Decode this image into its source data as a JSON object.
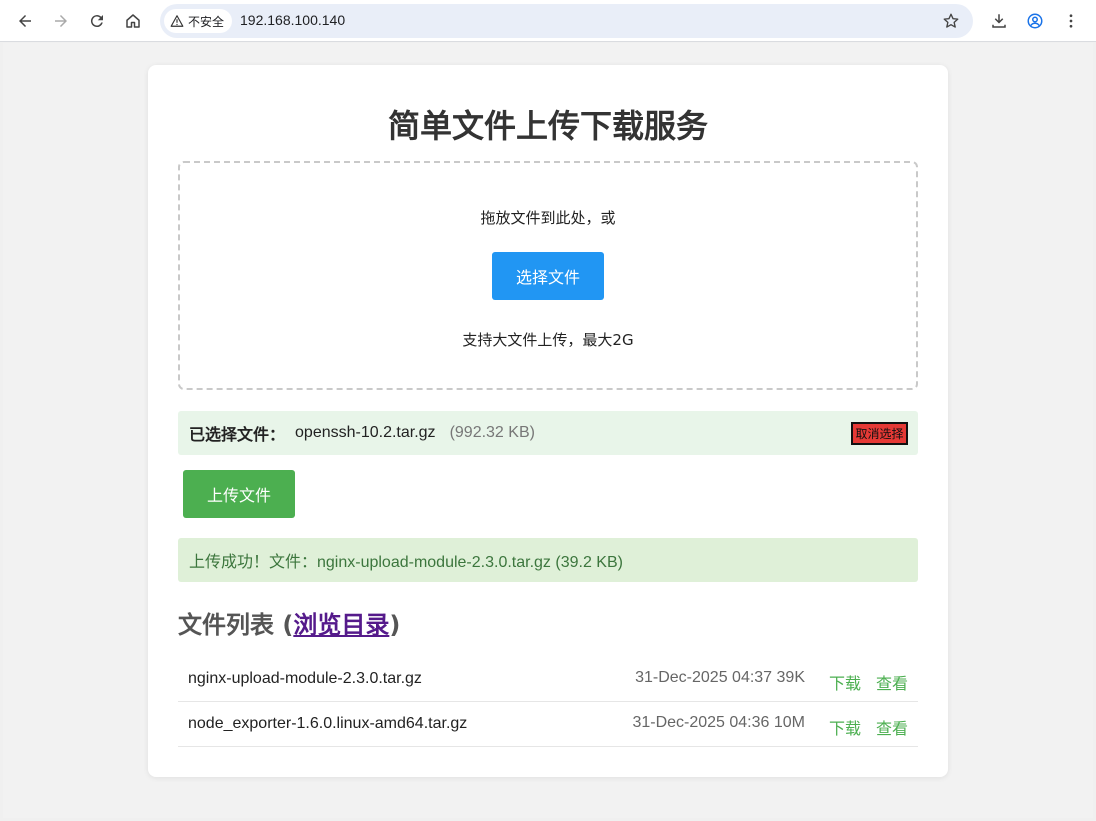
{
  "browser": {
    "security_label": "不安全",
    "url": "192.168.100.140"
  },
  "page": {
    "title": "简单文件上传下载服务",
    "dropzone": {
      "hint": "拖放文件到此处，或",
      "choose_button": "选择文件",
      "size_hint": "支持大文件上传，最大2G"
    },
    "selected": {
      "label": "已选择文件：",
      "file_name": "openssh-10.2.tar.gz",
      "file_size": "(992.32 KB)",
      "cancel_button": "取消选择"
    },
    "upload_button": "上传文件",
    "success_message": "上传成功！文件：nginx-upload-module-2.3.0.tar.gz (39.2 KB)",
    "file_list": {
      "heading": "文件列表 (",
      "browse_link": "浏览目录",
      "heading_close": ")",
      "rows": [
        {
          "name": "nginx-upload-module-2.3.0.tar.gz",
          "meta": "31-Dec-2025 04:37 39K",
          "download": "下载",
          "view": "查看"
        },
        {
          "name": "node_exporter-1.6.0.linux-amd64.tar.gz",
          "meta": "31-Dec-2025 04:36 10M",
          "download": "下载",
          "view": "查看"
        }
      ]
    }
  },
  "colors": {
    "choose_button": "#2196f3",
    "upload_button": "#4caf50",
    "cancel_button": "#e53935",
    "success_bg": "#dff0d8",
    "selected_bg": "#e8f5e9",
    "link_visited": "#551a8b"
  }
}
